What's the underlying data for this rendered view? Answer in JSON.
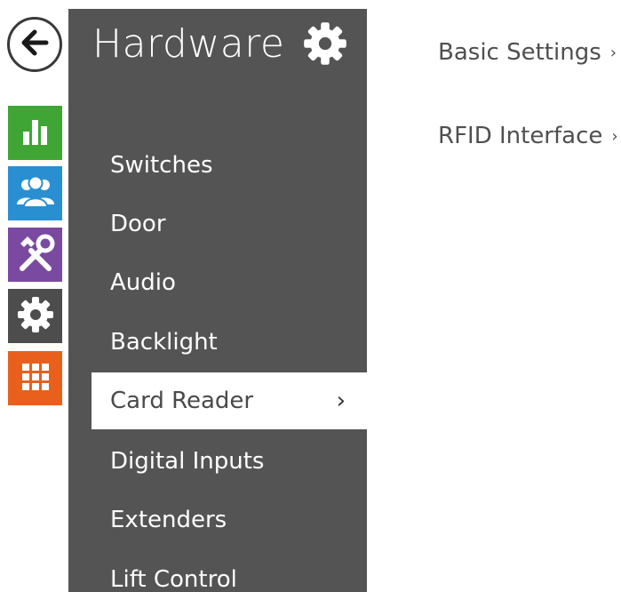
{
  "rail": {
    "items": [
      {
        "icon": "back-arrow-icon",
        "color": "#3a3a3a"
      },
      {
        "icon": "bar-chart-icon",
        "color": "#3fa535"
      },
      {
        "icon": "users-icon",
        "color": "#2a8fd1"
      },
      {
        "icon": "tools-icon",
        "color": "#7a4aa0"
      },
      {
        "icon": "gear-icon",
        "color": "#4d4d4d"
      },
      {
        "icon": "grid-icon",
        "color": "#e8601c"
      }
    ]
  },
  "menu": {
    "title": "Hardware",
    "title_icon": "gear-icon",
    "items": [
      {
        "label": "Switches"
      },
      {
        "label": "Door"
      },
      {
        "label": "Audio"
      },
      {
        "label": "Backlight"
      },
      {
        "label": "Card Reader",
        "active": true,
        "chevron": "›"
      },
      {
        "label": "Digital Inputs"
      },
      {
        "label": "Extenders"
      },
      {
        "label": "Lift Control"
      }
    ]
  },
  "submenu": {
    "items": [
      {
        "label": "Basic Settings",
        "chevron": "›"
      },
      {
        "label": "RFID Interface",
        "chevron": "›"
      }
    ]
  },
  "colors": {
    "panel": "#545454",
    "active_bg": "#ffffff",
    "text_light": "#ffffff",
    "text_dark": "#4f4f4f"
  }
}
